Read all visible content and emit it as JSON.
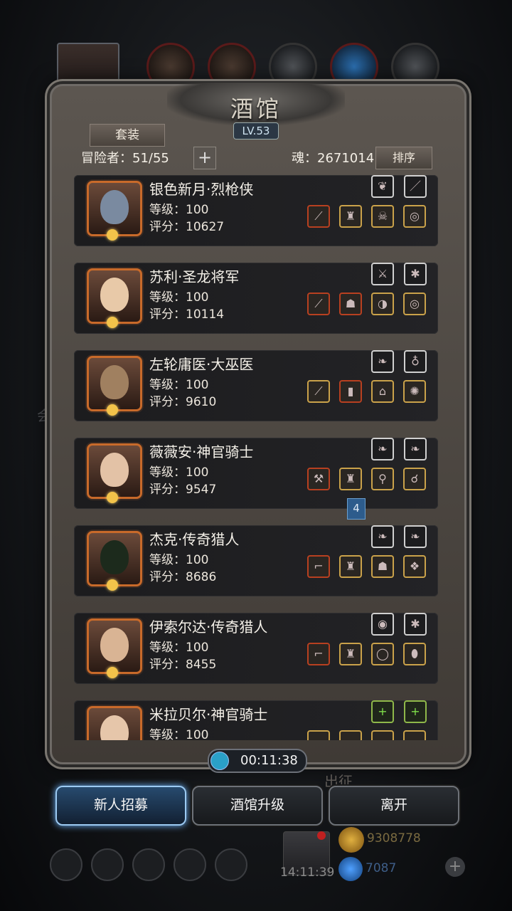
{
  "panel": {
    "title": "酒馆",
    "level": "LV.53",
    "tab_label": "套装",
    "adventurer_label": "冒险者：51/55",
    "soul_label": "魂：2671014",
    "sort_label": "排序"
  },
  "heroes": [
    {
      "name": "银色新月·烈枪侠",
      "level": "等级：100",
      "score": "评分：10627",
      "face": "#7a8aa0"
    },
    {
      "name": "苏利·圣龙将军",
      "level": "等级：100",
      "score": "评分：10114",
      "face": "#e8c9a8"
    },
    {
      "name": "左轮庸医·大巫医",
      "level": "等级：100",
      "score": "评分：9610",
      "face": "#a08060"
    },
    {
      "name": "薇薇安·神官骑士",
      "level": "等级：100",
      "score": "评分：9547",
      "face": "#e3c2a6"
    },
    {
      "name": "杰克·传奇猎人",
      "level": "等级：100",
      "score": "评分：8686",
      "face": "#1c2a1c"
    },
    {
      "name": "伊索尔达·传奇猎人",
      "level": "等级：100",
      "score": "评分：8455",
      "face": "#d9b494"
    },
    {
      "name": "米拉贝尔·神官骑士",
      "level": "等级：100",
      "score": "",
      "face": "#e6c6aa"
    }
  ],
  "page_flag": "4",
  "timer": "00:11:38",
  "background_label": "出征",
  "side_label": "会",
  "buttons": {
    "recruit": "新人招募",
    "upgrade": "酒馆升级",
    "leave": "离开"
  },
  "resources": {
    "gold": "9308778",
    "gems": "7087",
    "clock": "14:11:39"
  },
  "colors": {
    "accent_blue": "#6fb6ff",
    "portrait_border": "#c86a2a",
    "slot_gold": "#caa24a",
    "slot_red": "#b84020"
  }
}
